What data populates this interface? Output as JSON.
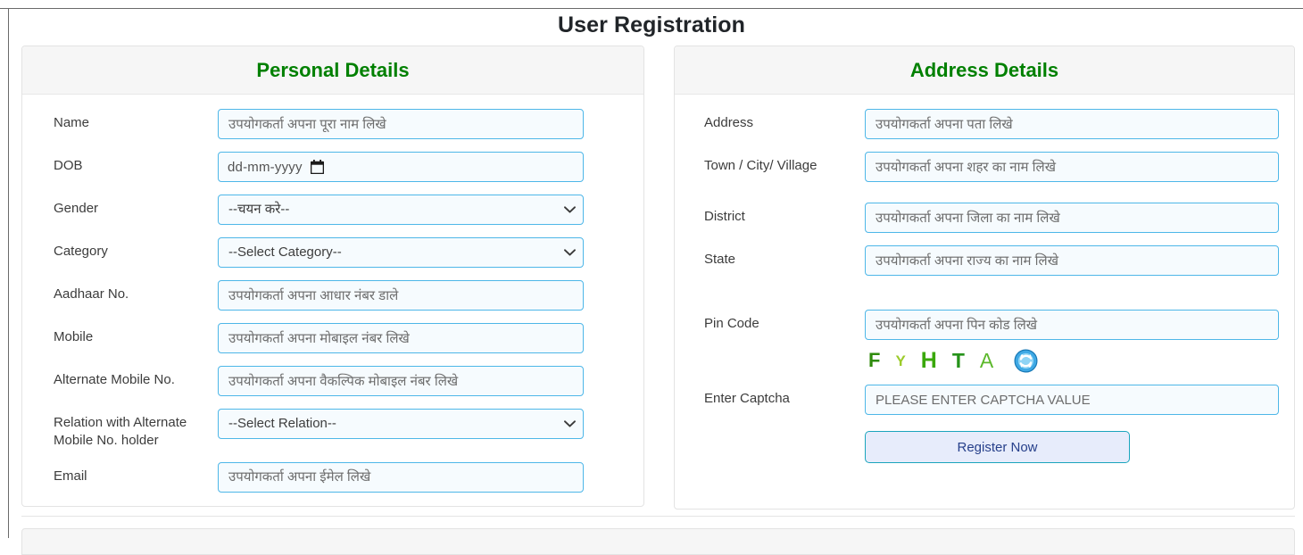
{
  "page": {
    "title": "User Registration"
  },
  "personal": {
    "heading": "Personal Details",
    "fields": {
      "name": {
        "label": "Name",
        "placeholder": "उपयोगकर्ता अपना पूरा नाम लिखे",
        "value": ""
      },
      "dob": {
        "label": "DOB",
        "placeholder": "dd-mm-yyyy",
        "value": ""
      },
      "gender": {
        "label": "Gender",
        "selected": "--चयन करे--"
      },
      "category": {
        "label": "Category",
        "selected": "--Select Category--"
      },
      "aadhaar": {
        "label": "Aadhaar No.",
        "placeholder": "उपयोगकर्ता अपना आधार नंबर डाले",
        "value": ""
      },
      "mobile": {
        "label": "Mobile",
        "placeholder": "उपयोगकर्ता अपना मोबाइल नंबर लिखे",
        "value": ""
      },
      "alt_mobile": {
        "label": "Alternate Mobile No.",
        "placeholder": "उपयोगकर्ता अपना वैकल्पिक मोबाइल नंबर लिखे",
        "value": ""
      },
      "relation": {
        "label": "Relation with Alternate Mobile No. holder",
        "selected": "--Select Relation--"
      },
      "email": {
        "label": "Email",
        "placeholder": "उपयोगकर्ता अपना ईमेल लिखे",
        "value": ""
      }
    }
  },
  "address": {
    "heading": "Address Details",
    "fields": {
      "address": {
        "label": "Address",
        "placeholder": "उपयोगकर्ता अपना पता लिखे",
        "value": ""
      },
      "town": {
        "label": "Town / City/ Village",
        "placeholder": "उपयोगकर्ता अपना शहर का नाम लिखे",
        "value": ""
      },
      "district": {
        "label": "District",
        "placeholder": "उपयोगकर्ता अपना जिला का नाम लिखे",
        "value": ""
      },
      "state": {
        "label": "State",
        "placeholder": "उपयोगकर्ता अपना राज्य का नाम लिखे",
        "value": ""
      },
      "pincode": {
        "label": "Pin Code",
        "placeholder": "उपयोगकर्ता अपना पिन कोड लिखे",
        "value": ""
      },
      "captcha": {
        "label": "Enter Captcha",
        "placeholder": "PLEASE ENTER CAPTCHA VALUE",
        "value": ""
      }
    },
    "captcha_image": {
      "characters": [
        "F",
        "Y",
        "H",
        "T",
        "A"
      ],
      "text": "FYHTA",
      "refresh_icon": "refresh-icon"
    },
    "submit_label": "Register Now"
  },
  "colors": {
    "heading_green": "#008000",
    "input_border_blue": "#4eb7e8",
    "input_bg": "#f6fbfe",
    "button_bg": "#e7ecfb",
    "button_border": "#1ba5bd",
    "button_text": "#27408b",
    "card_header_bg": "#f6f6f6"
  }
}
